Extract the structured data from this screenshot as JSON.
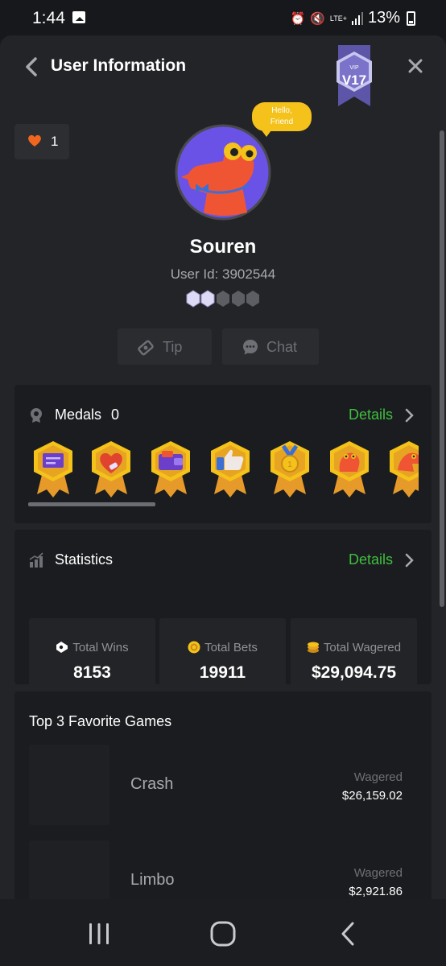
{
  "status_bar": {
    "time": "1:44",
    "network": "LTE+",
    "battery": "13%",
    "icons": [
      "gallery-icon",
      "alarm-icon",
      "mute-icon",
      "lte-icon",
      "signal-icon",
      "battery-icon"
    ]
  },
  "header": {
    "title": "User Information",
    "vip_level": "V17",
    "vip_small": "VIP"
  },
  "profile": {
    "likes": "1",
    "bubble_line1": "Hello,",
    "bubble_line2": "Friend",
    "username": "Souren",
    "user_id": "User Id: 3902544",
    "rank_gems_filled": 2,
    "rank_gems_total": 5
  },
  "actions": {
    "tip_label": "Tip",
    "chat_label": "Chat"
  },
  "medals": {
    "label": "Medals",
    "count": "0",
    "details_label": "Details",
    "items": [
      "message-medal",
      "heart-medal",
      "wallet-medal",
      "thumbs-up-medal",
      "coin-medal",
      "dino-medal",
      "dino-run-medal"
    ]
  },
  "statistics": {
    "label": "Statistics",
    "details_label": "Details",
    "items": [
      {
        "label": "Total Wins",
        "value": "8153"
      },
      {
        "label": "Total Bets",
        "value": "19911"
      },
      {
        "label": "Total Wagered",
        "value": "$29,094.75"
      }
    ]
  },
  "favorite_games": {
    "title": "Top 3 Favorite Games",
    "games": [
      {
        "name": "Crash",
        "wagered_label": "Wagered",
        "wagered": "$26,159.02"
      },
      {
        "name": "Limbo",
        "wagered_label": "Wagered",
        "wagered": "$2,921.86"
      }
    ]
  },
  "colors": {
    "background": "#17181b",
    "panel": "#232427",
    "card": "#1b1c1f",
    "accent_green": "#3fbf3f",
    "heart_orange": "#f0661e",
    "vip_purple": "#7b73c9",
    "bubble_yellow": "#f4c21a",
    "avatar_purple": "#6b52e6"
  }
}
